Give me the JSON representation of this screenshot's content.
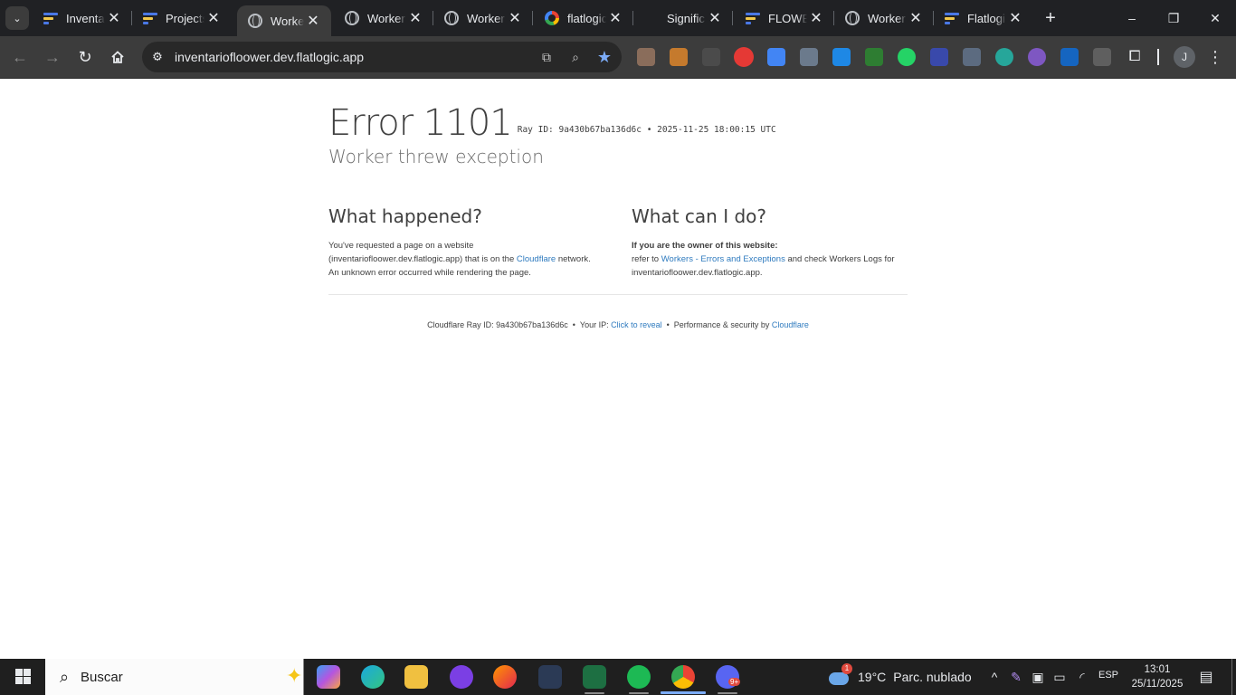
{
  "browser": {
    "tabs": [
      {
        "title": "Inventa",
        "favicon": "flatlogic-icon"
      },
      {
        "title": "Projects",
        "favicon": "flatlogic-icon"
      },
      {
        "title": "Worker",
        "favicon": "globe-icon",
        "active": true
      },
      {
        "title": "Worker",
        "favicon": "globe-icon"
      },
      {
        "title": "Worker",
        "favicon": "globe-icon"
      },
      {
        "title": "flatlogic",
        "favicon": "google-icon"
      },
      {
        "title": "Signific",
        "favicon": "none"
      },
      {
        "title": "FLOWE",
        "favicon": "flatlogic-icon"
      },
      {
        "title": "Worker",
        "favicon": "globe-icon"
      },
      {
        "title": "Flatlogi",
        "favicon": "flatlogic-icon"
      }
    ],
    "new_tab_label": "+",
    "window_controls": {
      "minimize": "–",
      "restore": "❐",
      "close": "✕"
    },
    "url": "inventariofloower.dev.flatlogic.app",
    "profile_initial": "J",
    "accent_color": "#7cacf8"
  },
  "page": {
    "title": "Error 1101",
    "ray_line": "Ray ID: 9a430b67ba136d6c • 2025-11-25 18:00:15 UTC",
    "subtitle": "Worker threw exception",
    "what_happened": {
      "heading": "What happened?",
      "text_before": "You've requested a page on a website (inventariofloower.dev.flatlogic.app) that is on the ",
      "link": "Cloudflare",
      "text_after": " network. An unknown error occurred while rendering the page."
    },
    "what_can_i_do": {
      "heading": "What can I do?",
      "bold": "If you are the owner of this website:",
      "text_before": "refer to ",
      "link": "Workers - Errors and Exceptions",
      "text_after": " and check Workers Logs for inventariofloower.dev.flatlogic.app."
    },
    "footer": {
      "ray": "Cloudflare Ray ID: 9a430b67ba136d6c",
      "ip_label": "Your IP:",
      "ip_link": "Click to reveal",
      "perf_label": "Performance & security by",
      "perf_link": "Cloudflare"
    },
    "link_color": "#2f7bbf"
  },
  "taskbar": {
    "search_placeholder": "Buscar",
    "weather_temp": "19°C",
    "weather_desc": "Parc. nublado",
    "weather_alert": "1",
    "language": "ESP",
    "time": "13:01",
    "date": "25/11/2025",
    "discord_badge": "9+"
  }
}
